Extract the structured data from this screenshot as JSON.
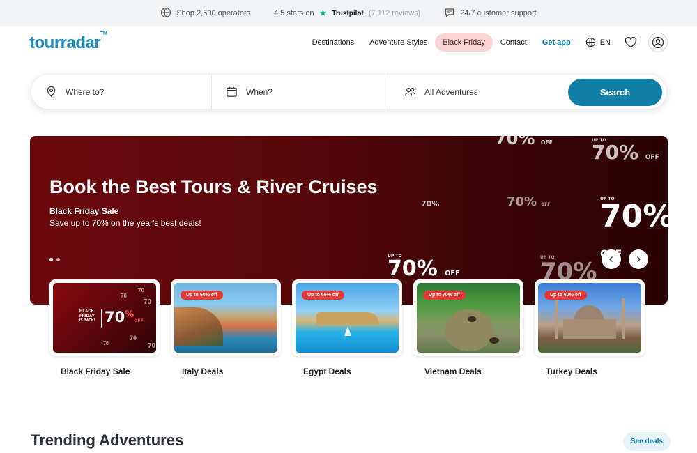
{
  "topbar": {
    "operators": "Shop 2,500 operators",
    "rating": "4.5 stars on",
    "trustpilot": "Trustpilot",
    "reviews": "(7,112 reviews)",
    "support": "24/7 customer support"
  },
  "header": {
    "logo": "tourradar",
    "nav": {
      "destinations": "Destinations",
      "adventure_styles": "Adventure Styles",
      "black_friday": "Black Friday",
      "contact": "Contact",
      "get_app": "Get app",
      "lang": "EN"
    }
  },
  "search": {
    "where": "Where to?",
    "when": "When?",
    "adventures": "All Adventures",
    "button": "Search"
  },
  "hero": {
    "title": "Book the Best Tours & River Cruises",
    "subtitle": "Black Friday Sale",
    "description": "Save up to 70% on the year's best deals!",
    "promo_up": "UP TO",
    "promo_num": "70%",
    "promo_off": "OFF"
  },
  "cards": [
    {
      "label": "Black Friday Sale",
      "badge": ""
    },
    {
      "label": "Italy Deals",
      "badge": "Up to 60% off"
    },
    {
      "label": "Egypt Deals",
      "badge": "Up to 65% off"
    },
    {
      "label": "Vietnam Deals",
      "badge": "Up to 70% off"
    },
    {
      "label": "Turkey Deals",
      "badge": "Up to 60% off"
    }
  ],
  "bf_card": {
    "line1": "BLACK",
    "line2": "FRIDAY",
    "line3": "IS BACK!",
    "num": "70",
    "pct": "%",
    "off": "OFF"
  },
  "trending": {
    "title": "Trending Adventures",
    "see_deals": "See deals"
  },
  "colors": {
    "brand": "#1b8bbf",
    "primary_button": "#0f7fa8",
    "sale_badge": "#e53935",
    "hero_bg": "#5a0709"
  },
  "icons": {
    "operators": "operators-globe-icon",
    "star": "trustpilot-star-icon",
    "support": "chat-icon",
    "lang": "globe-icon",
    "wishlist": "heart-icon",
    "account": "user-icon",
    "where": "location-pin-icon",
    "when": "calendar-icon",
    "adventures": "people-icon"
  }
}
